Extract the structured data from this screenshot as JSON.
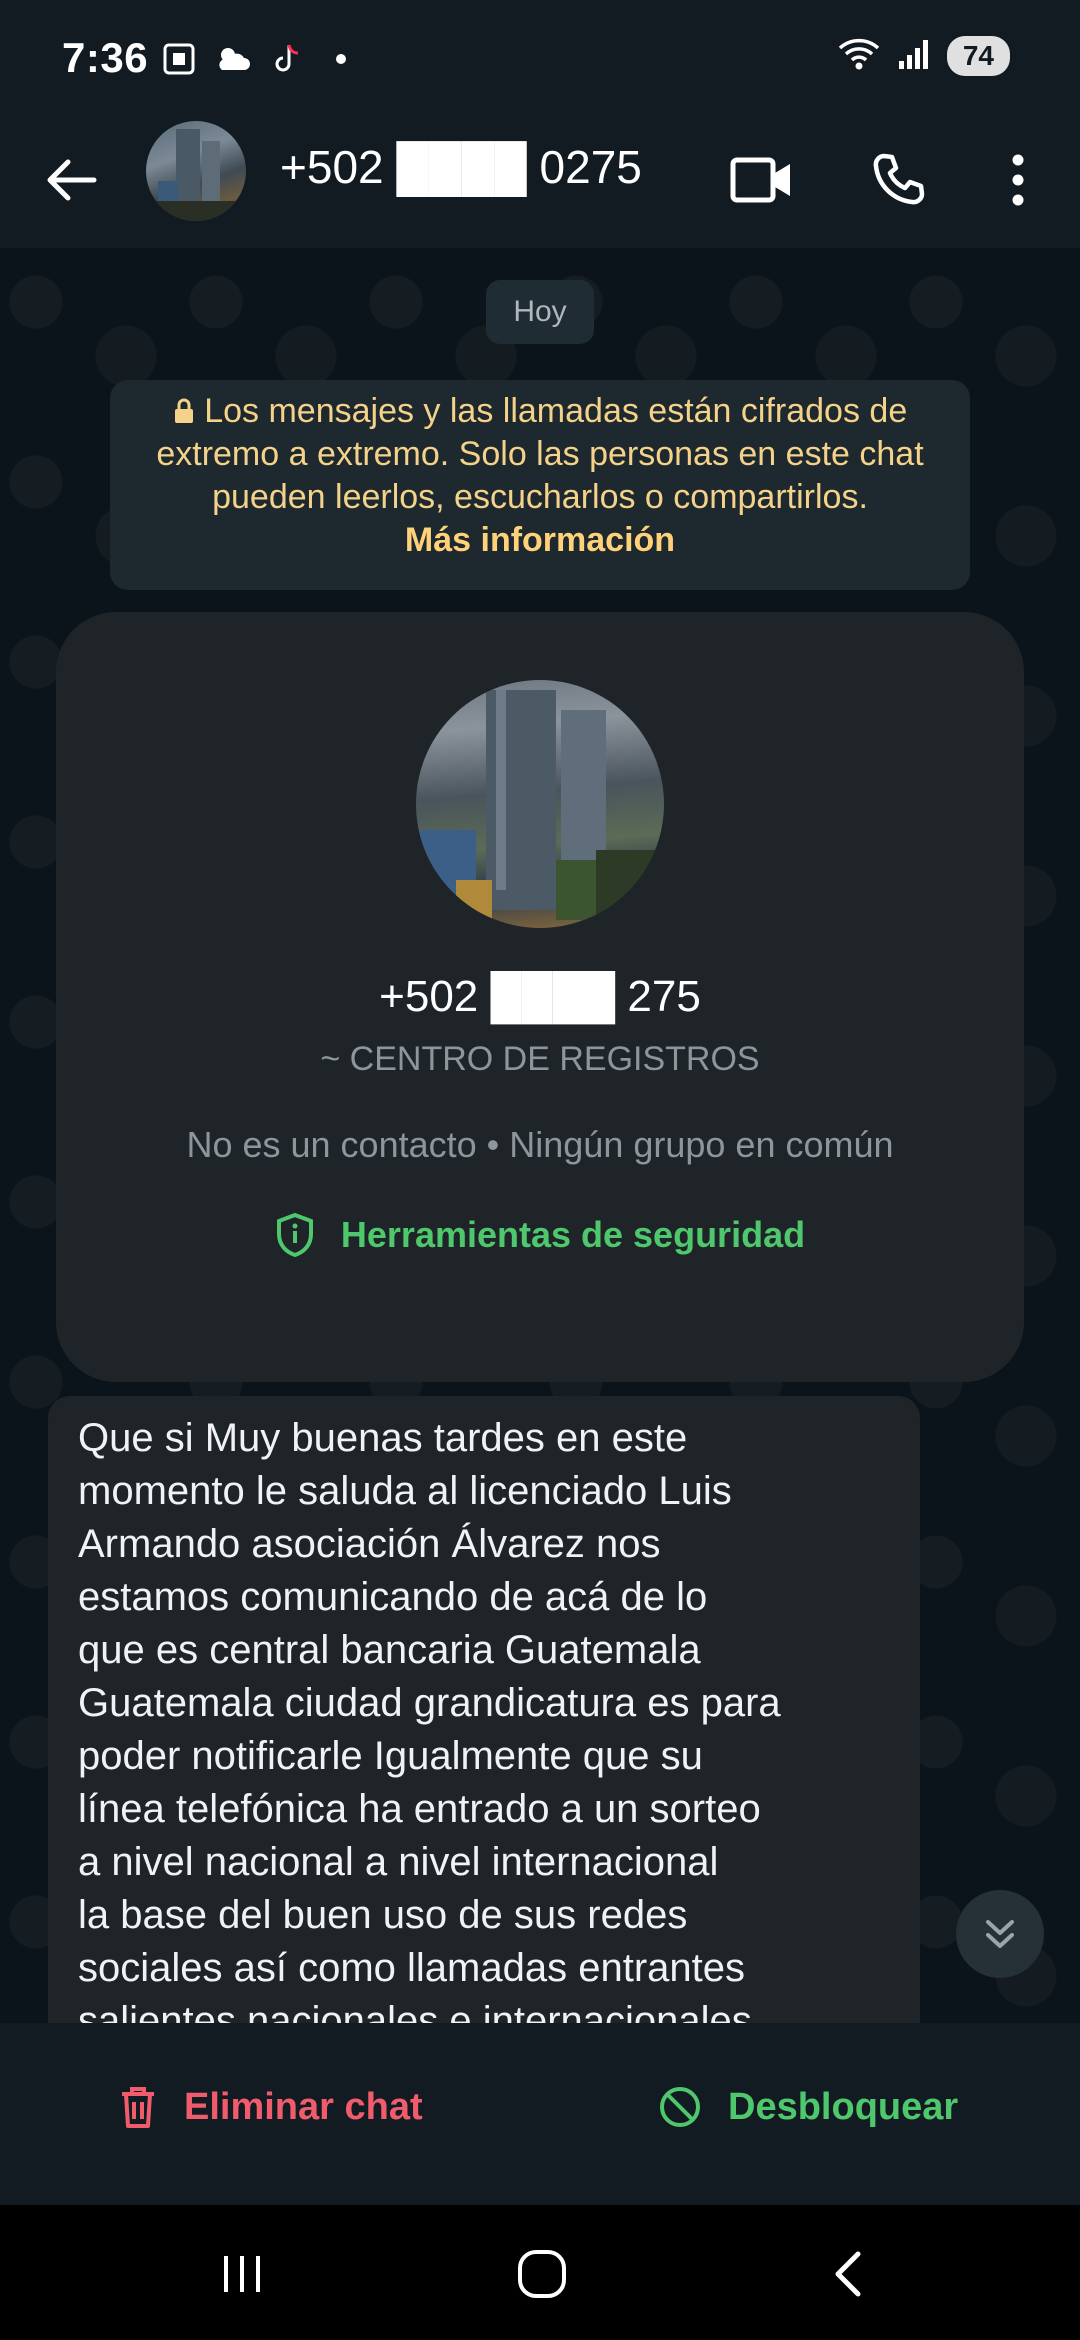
{
  "status_bar": {
    "time": "7:36",
    "battery": "74",
    "left_icons": [
      "screenshot-icon",
      "weather-icon",
      "tiktok-icon",
      "dot-icon"
    ],
    "right_icons": [
      "wifi-icon",
      "signal-icon"
    ]
  },
  "header": {
    "contact": "+502 ████ 0275",
    "icons": [
      "back-arrow-icon",
      "video-call-icon",
      "phone-icon",
      "more-options-icon"
    ]
  },
  "chat": {
    "date_chip": "Hoy",
    "encryption_notice": "Los mensajes y las llamadas están cifrados de extremo a extremo. Solo las personas en este chat pueden leerlos, escucharlos o compartirlos.",
    "encryption_link": "Más información",
    "contact_card": {
      "phone": "+502 ████ 275",
      "name": "~ CENTRO DE REGISTROS",
      "meta": "No es un contacto • Ningún grupo en común",
      "security_tools": "Herramientas de seguridad"
    },
    "message": "Que si Muy buenas tardes en este\nmomento le saluda al licenciado Luis\nArmando asociación Álvarez nos\nestamos comunicando de acá de lo\nque es central bancaria Guatemala\nGuatemala ciudad grandicatura es para\npoder notificarle Igualmente que su\nlínea telefónica ha entrado a un sorteo\na nivel nacional a nivel internacional\nla base del buen uso de sus redes\nsociales así como llamadas entrantes\nsalientes nacionales e internacionales"
  },
  "actions": {
    "delete_chat": "Eliminar chat",
    "unblock": "Desbloquear"
  },
  "colors": {
    "delete": "#f15c6d",
    "unblock": "#4fc86d",
    "notice": "#f4d28a"
  }
}
